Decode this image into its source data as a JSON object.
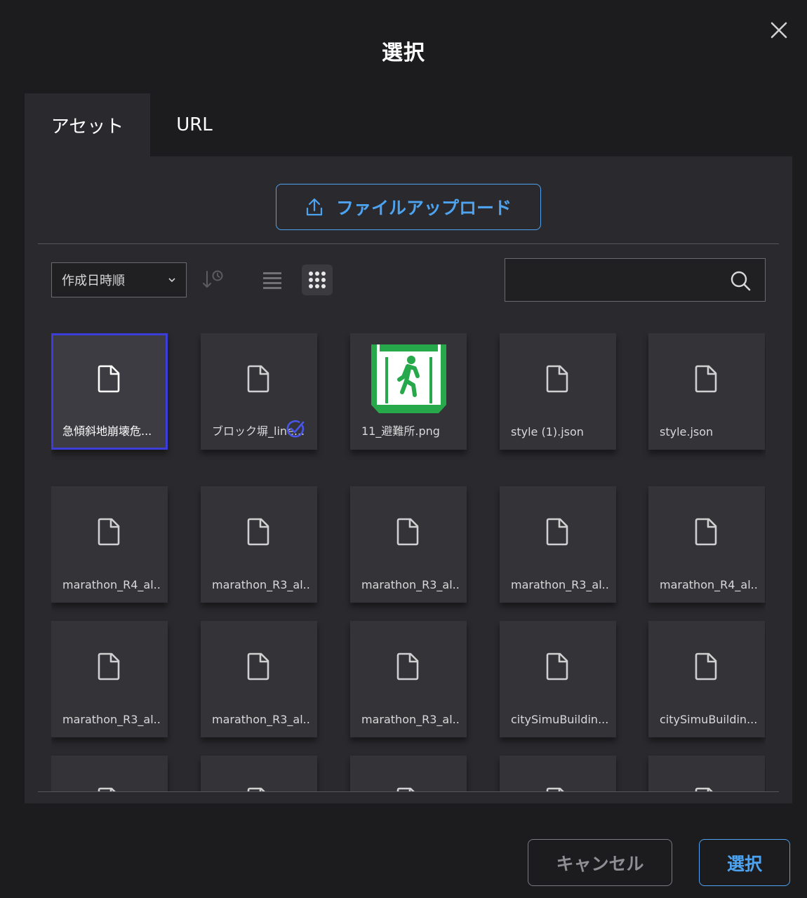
{
  "dialog": {
    "title": "選択"
  },
  "tabs": [
    {
      "label": "アセット",
      "active": true
    },
    {
      "label": "URL",
      "active": false
    }
  ],
  "upload": {
    "label": "ファイルアップロード"
  },
  "toolbar": {
    "sort_value": "作成日時順",
    "view_mode": "grid"
  },
  "search": {
    "value": "",
    "placeholder": ""
  },
  "files": [
    {
      "name": "急傾斜地崩壊危...",
      "selected": true
    },
    {
      "name": "ブロック塀_line...",
      "checked": true
    },
    {
      "name": "11_避難所.png",
      "thumbnail": "emergency-exit-image"
    },
    {
      "name": "style (1).json"
    },
    {
      "name": "style.json"
    },
    {
      "name": "marathon_R4_al..."
    },
    {
      "name": "marathon_R3_al..."
    },
    {
      "name": "marathon_R3_al..."
    },
    {
      "name": "marathon_R3_al..."
    },
    {
      "name": "marathon_R4_al..."
    },
    {
      "name": "marathon_R3_al..."
    },
    {
      "name": "marathon_R3_al..."
    },
    {
      "name": "marathon_R3_al..."
    },
    {
      "name": "citySimuBuildin..."
    },
    {
      "name": "citySimuBuildin..."
    },
    {
      "name": ""
    },
    {
      "name": ""
    },
    {
      "name": ""
    },
    {
      "name": ""
    },
    {
      "name": ""
    }
  ],
  "footer": {
    "cancel_label": "キャンセル",
    "select_label": "選択"
  },
  "colors": {
    "accent": "#4da3f0",
    "selection": "#3d3dd9",
    "background": "#1c1c1e",
    "panel": "#2a2a2e"
  }
}
